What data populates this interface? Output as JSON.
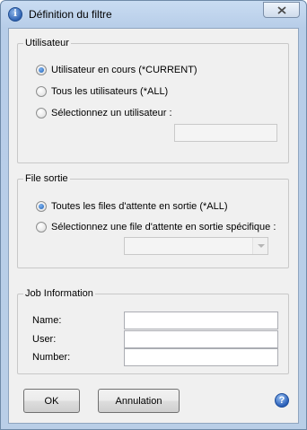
{
  "window": {
    "title": "Définition du filtre",
    "app_icon": "i"
  },
  "utilisateur": {
    "legend": "Utilisateur",
    "options": [
      {
        "label": "Utilisateur en cours (*CURRENT)",
        "checked": true
      },
      {
        "label": "Tous les utilisateurs (*ALL)",
        "checked": false
      },
      {
        "label": "Sélectionnez un utilisateur :",
        "checked": false
      }
    ],
    "user_value": ""
  },
  "file_sortie": {
    "legend": "File sortie",
    "options": [
      {
        "label": "Toutes les files d'attente en sortie (*ALL)",
        "checked": true
      },
      {
        "label": "Sélectionnez une file d'attente en sortie spécifique :",
        "checked": false
      }
    ],
    "queue_selected": ""
  },
  "job_information": {
    "legend": "Job Information",
    "fields": [
      {
        "label": "Name:",
        "value": ""
      },
      {
        "label": "User:",
        "value": ""
      },
      {
        "label": "Number:",
        "value": ""
      }
    ]
  },
  "buttons": {
    "ok": "OK",
    "cancel": "Annulation",
    "help_icon": "?"
  },
  "colors": {
    "titlebar": "#c9dcf2",
    "client_bg": "#f0f0f0",
    "radio_checked": "#1b5fb5"
  }
}
